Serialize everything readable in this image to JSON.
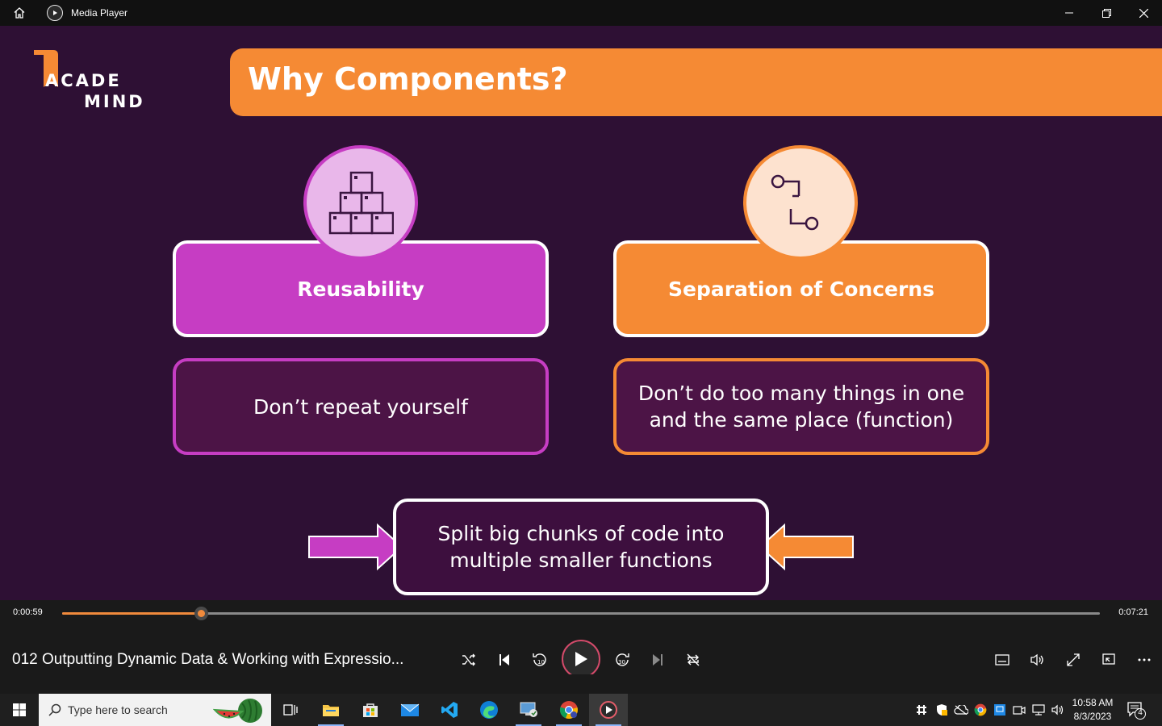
{
  "window": {
    "title": "Media Player",
    "icons": [
      "home-icon",
      "media-player-icon",
      "minimize-icon",
      "restore-icon",
      "close-icon"
    ]
  },
  "slide": {
    "logo_line1": "ACADE",
    "logo_line2": "MIND",
    "title": "Why Components?",
    "left_card": {
      "heading": "Reusability",
      "body": "Don’t repeat yourself",
      "icon": "stacked-boxes-icon",
      "color": "#c63dc3"
    },
    "right_card": {
      "heading": "Separation of Concerns",
      "body_line1": "Don’t do too many things in one",
      "body_line2": "and the same place (function)",
      "icon": "flow-connector-icon",
      "color": "#f58a34"
    },
    "bottom_box": {
      "line1": "Split big chunks of code into",
      "line2": "multiple smaller functions"
    },
    "background": "#2e1034"
  },
  "player": {
    "current_time": "0:00:59",
    "duration": "0:07:21",
    "progress_fraction": 0.1338,
    "video_title": "012 Outputting Dynamic Data & Working with Expressio...",
    "accent": "#f08a3c"
  },
  "taskbar": {
    "search_placeholder": "Type here to search",
    "time": "10:58 AM",
    "date": "8/3/2023",
    "notification_count": "4"
  }
}
